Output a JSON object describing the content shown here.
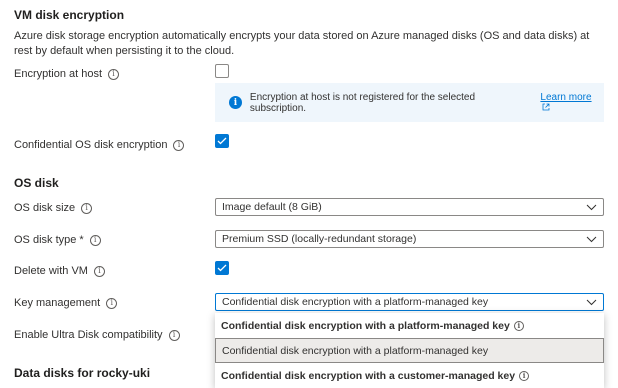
{
  "vm_disk_encryption": {
    "title": "VM disk encryption",
    "description": "Azure disk storage encryption automatically encrypts your data stored on Azure managed disks (OS and data disks) at rest by default when persisting it to the cloud.",
    "encryption_at_host": {
      "label": "Encryption at host",
      "checked": false
    },
    "infobar": {
      "text": "Encryption at host is not registered for the selected subscription.",
      "link": "Learn more"
    },
    "confidential_os_disk_encryption": {
      "label": "Confidential OS disk encryption",
      "checked": true
    }
  },
  "os_disk": {
    "title": "OS disk",
    "disk_size": {
      "label": "OS disk size",
      "value": "Image default (8 GiB)"
    },
    "disk_type": {
      "label": "OS disk type *",
      "value": "Premium SSD (locally-redundant storage)"
    },
    "delete_with_vm": {
      "label": "Delete with VM",
      "checked": true
    },
    "key_management": {
      "label": "Key management",
      "value": "Confidential disk encryption with a platform-managed key",
      "options": [
        "Confidential disk encryption with a platform-managed key",
        "Confidential disk encryption with a platform-managed key",
        "Confidential disk encryption with a customer-managed key"
      ]
    },
    "ultra_disk": {
      "label": "Enable Ultra Disk compatibility"
    }
  },
  "data_disks": {
    "title": "Data disks for rocky-uki"
  },
  "colors": {
    "accent": "#0078d4",
    "infobar_bg": "#eff6fc",
    "text": "#323130"
  }
}
